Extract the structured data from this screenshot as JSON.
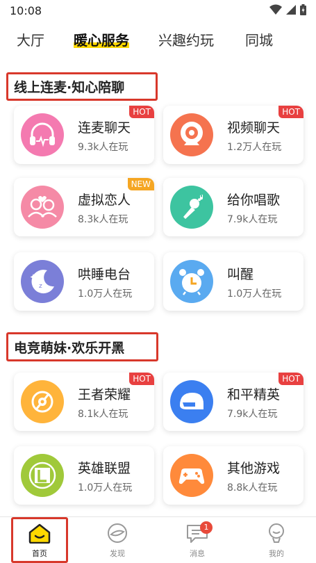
{
  "status": {
    "time": "10:08"
  },
  "tabs": [
    "大厅",
    "暖心服务",
    "兴趣约玩",
    "同城"
  ],
  "sections": [
    {
      "title": "线上连麦·知心陪聊"
    },
    {
      "title": "电竞萌妹·欢乐开黑"
    }
  ],
  "cards": [
    {
      "name": "连麦聊天",
      "count": "9.3k人在玩",
      "badge": "HOT",
      "color": "#f47ab0"
    },
    {
      "name": "视频聊天",
      "count": "1.2万人在玩",
      "badge": "HOT",
      "color": "#f5734f"
    },
    {
      "name": "虚拟恋人",
      "count": "8.3k人在玩",
      "badge": "NEW",
      "color": "#f58aa6"
    },
    {
      "name": "给你唱歌",
      "count": "7.9k人在玩",
      "badge": "",
      "color": "#3dc4a0"
    },
    {
      "name": "哄睡电台",
      "count": "1.0万人在玩",
      "badge": "",
      "color": "#7b7fd8"
    },
    {
      "name": "叫醒",
      "count": "1.0万人在玩",
      "badge": "",
      "color": "#5aaaf0"
    },
    {
      "name": "王者荣耀",
      "count": "8.1k人在玩",
      "badge": "HOT",
      "color": "#ffb43b"
    },
    {
      "name": "和平精英",
      "count": "7.9k人在玩",
      "badge": "HOT",
      "color": "#3b7ff0"
    },
    {
      "name": "英雄联盟",
      "count": "1.0万人在玩",
      "badge": "",
      "color": "#a0c93a"
    },
    {
      "name": "其他游戏",
      "count": "8.8k人在玩",
      "badge": "",
      "color": "#ff8a3b"
    }
  ],
  "badge_colors": {
    "HOT": "#e84040",
    "NEW": "#f5a623"
  },
  "bottom_nav": [
    {
      "label": "首页"
    },
    {
      "label": "发现"
    },
    {
      "label": "消息",
      "badge": "1"
    },
    {
      "label": "我的"
    }
  ]
}
